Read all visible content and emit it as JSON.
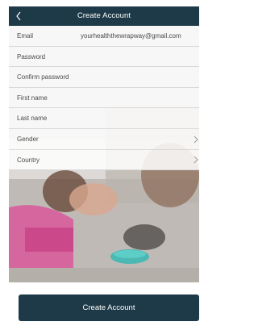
{
  "header": {
    "title": "Create Account",
    "back_icon": "chevron-left-icon"
  },
  "form": {
    "fields": [
      {
        "label": "Email",
        "value": "yourhealththewrapway@gmail.com"
      },
      {
        "label": "Password",
        "value": ""
      },
      {
        "label": "Confirm password",
        "value": ""
      },
      {
        "label": "First name",
        "value": ""
      },
      {
        "label": "Last name",
        "value": ""
      },
      {
        "label": "Gender",
        "value": ""
      },
      {
        "label": "Country",
        "value": ""
      }
    ],
    "chevron_icon": "chevron-right-icon"
  },
  "footer": {
    "create_label": "Create Account"
  },
  "colors": {
    "header_bg": "#1e3a48",
    "button_bg": "#1e3a48",
    "row_bg": "#ffffff"
  }
}
